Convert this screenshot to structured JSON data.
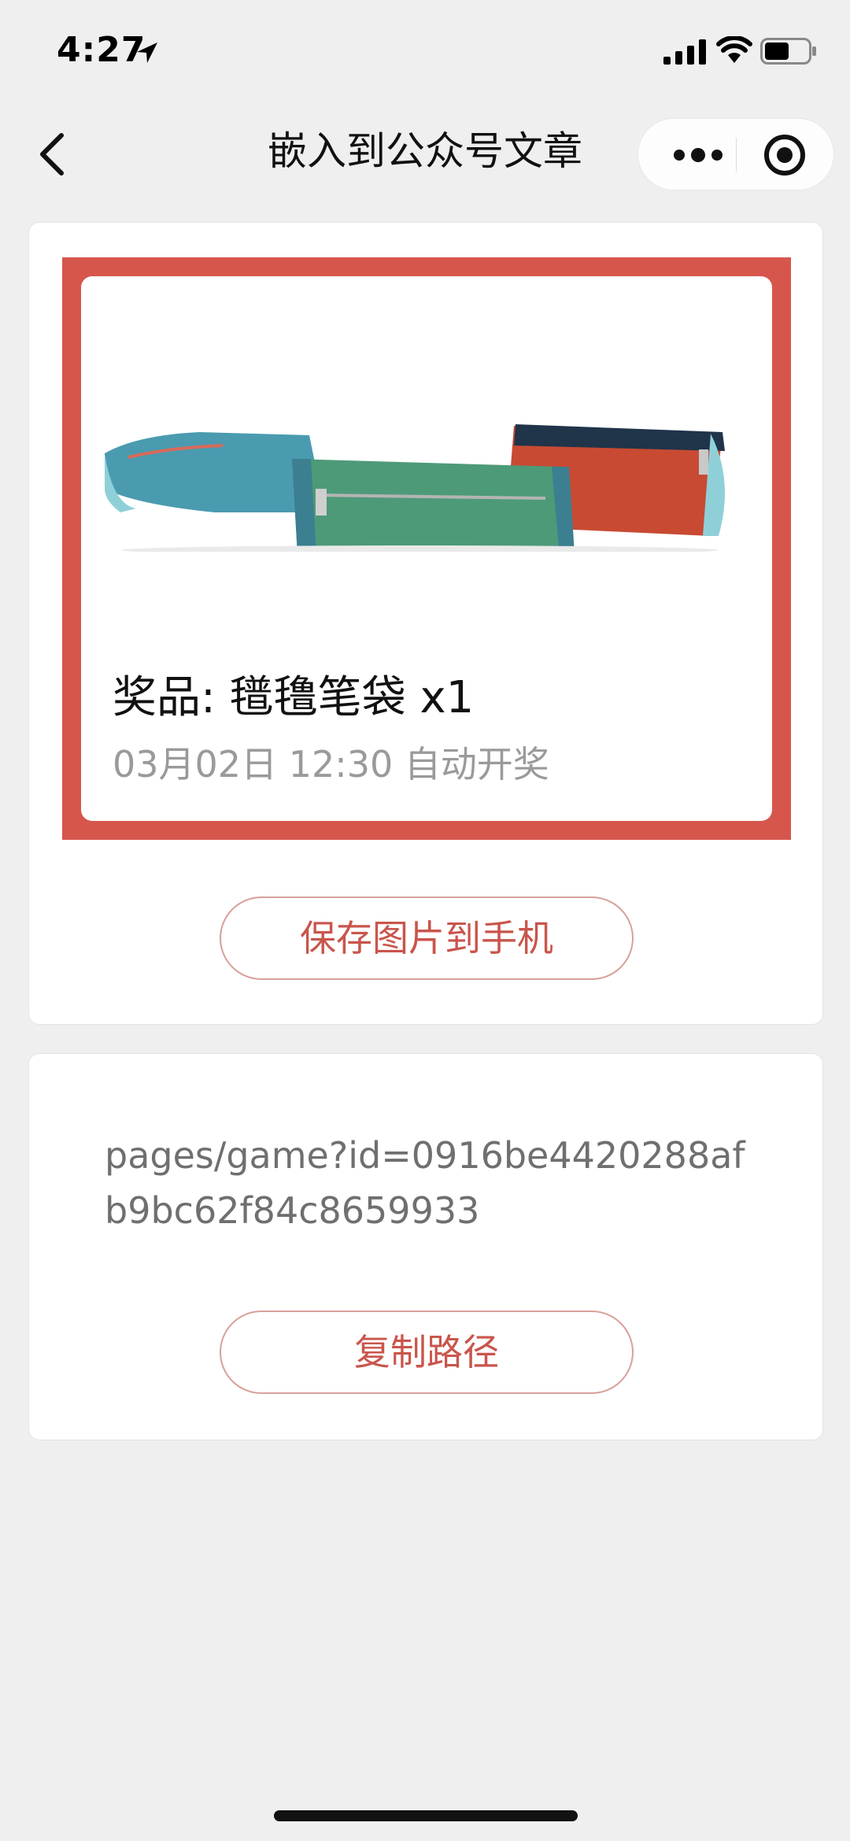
{
  "status": {
    "time": "4:27"
  },
  "nav": {
    "title": "嵌入到公众号文章"
  },
  "poster": {
    "prize_text": "奖品: 氆氇笔袋 x1",
    "draw_time": "03月02日 12:30 自动开奖",
    "accent_color": "#d6564c"
  },
  "actions": {
    "save_label": "保存图片到手机",
    "copy_label": "复制路径"
  },
  "path": {
    "value": "pages/game?id=0916be4420288afb9bc62f84c8659933"
  },
  "icons": {
    "back": "chevron-left-icon",
    "more": "more-dots-icon",
    "close": "target-close-icon",
    "location": "location-arrow-icon",
    "signal": "cellular-signal-icon",
    "wifi": "wifi-icon",
    "battery": "battery-icon"
  }
}
